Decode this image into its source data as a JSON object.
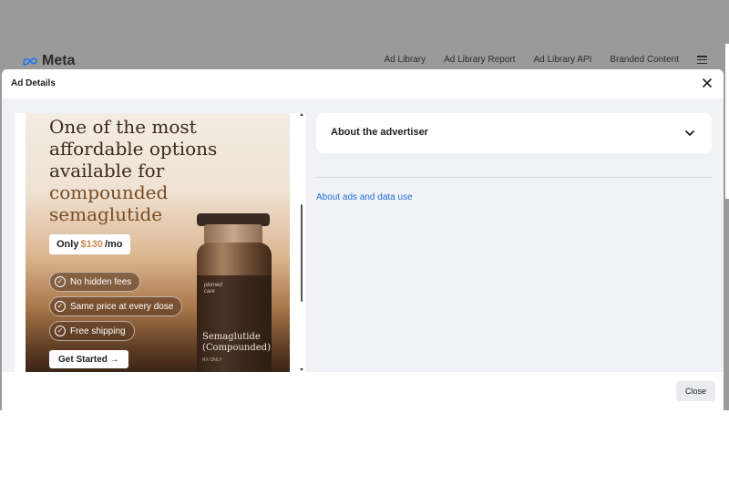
{
  "background_page": {
    "logo_text": "Meta",
    "nav": [
      "Ad Library",
      "Ad Library Report",
      "Ad Library API",
      "Branded Content"
    ],
    "menu_icon": "hamburger-icon"
  },
  "modal": {
    "title": "Ad Details",
    "close_icon": "close-icon",
    "footer_close_label": "Close"
  },
  "ad_creative": {
    "headline_lines": [
      "One of the most",
      "affordable options",
      "available for",
      "compounded",
      "semaglutide"
    ],
    "price_prefix": "Only",
    "price_amount": "$130",
    "price_suffix": "/mo",
    "features": [
      "No hidden fees",
      "Same price at every dose",
      "Free shipping"
    ],
    "feature_icon": "check-circle-icon",
    "cta_label": "Get Started →",
    "vial_brand_line1": "plumed",
    "vial_brand_line2": "care",
    "vial_name_line1": "Semaglutide",
    "vial_name_line2": "(Compounded)",
    "vial_rx": "RX ONLY"
  },
  "details": {
    "advertiser_section_label": "About the advertiser",
    "expand_icon": "chevron-down-icon",
    "about_link": "About ads and data use"
  },
  "colors": {
    "overlay": "#9a9a9a",
    "link": "#216fdb",
    "price_accent": "#c8894d"
  }
}
